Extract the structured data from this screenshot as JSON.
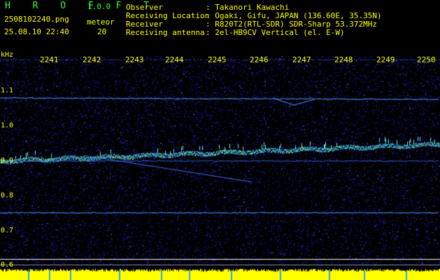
{
  "app": {
    "logo": "H R O F F T",
    "version": "1.0.0"
  },
  "file": {
    "name": "2508102240.png",
    "datetime": "25.08.10 22:40"
  },
  "meteor": {
    "label": "meteor",
    "count": "20"
  },
  "info": [
    {
      "key": "Observer",
      "value": ": Takanori Kawachi"
    },
    {
      "key": "Receiving Location",
      "value": ": Ogaki, Gifu, JAPAN (136.60E, 35.35N)"
    },
    {
      "key": "Receiver",
      "value": ": R820T2(RTL-SDR) SDR-Sharp 53.372MHz"
    },
    {
      "key": "Receiving antenna",
      "value": ": 2el-HB9CV Vertical (el. E-W)"
    }
  ],
  "axis": {
    "y_unit": "kHz",
    "y_ticks": [
      "1.1",
      "1.0",
      "0.9",
      "0.8",
      "0.7",
      "0.6"
    ],
    "x_ticks": [
      "2241",
      "2242",
      "2243",
      "2244",
      "2245",
      "2246",
      "2247",
      "2248",
      "2249",
      "2250"
    ]
  },
  "colors": {
    "background": "#000000",
    "noise": "#1a1aa8",
    "echo": "#2ec8ff",
    "text_yellow": "#ffff00",
    "text_green": "#33ff33",
    "signal_bar": "#ffff00"
  }
}
